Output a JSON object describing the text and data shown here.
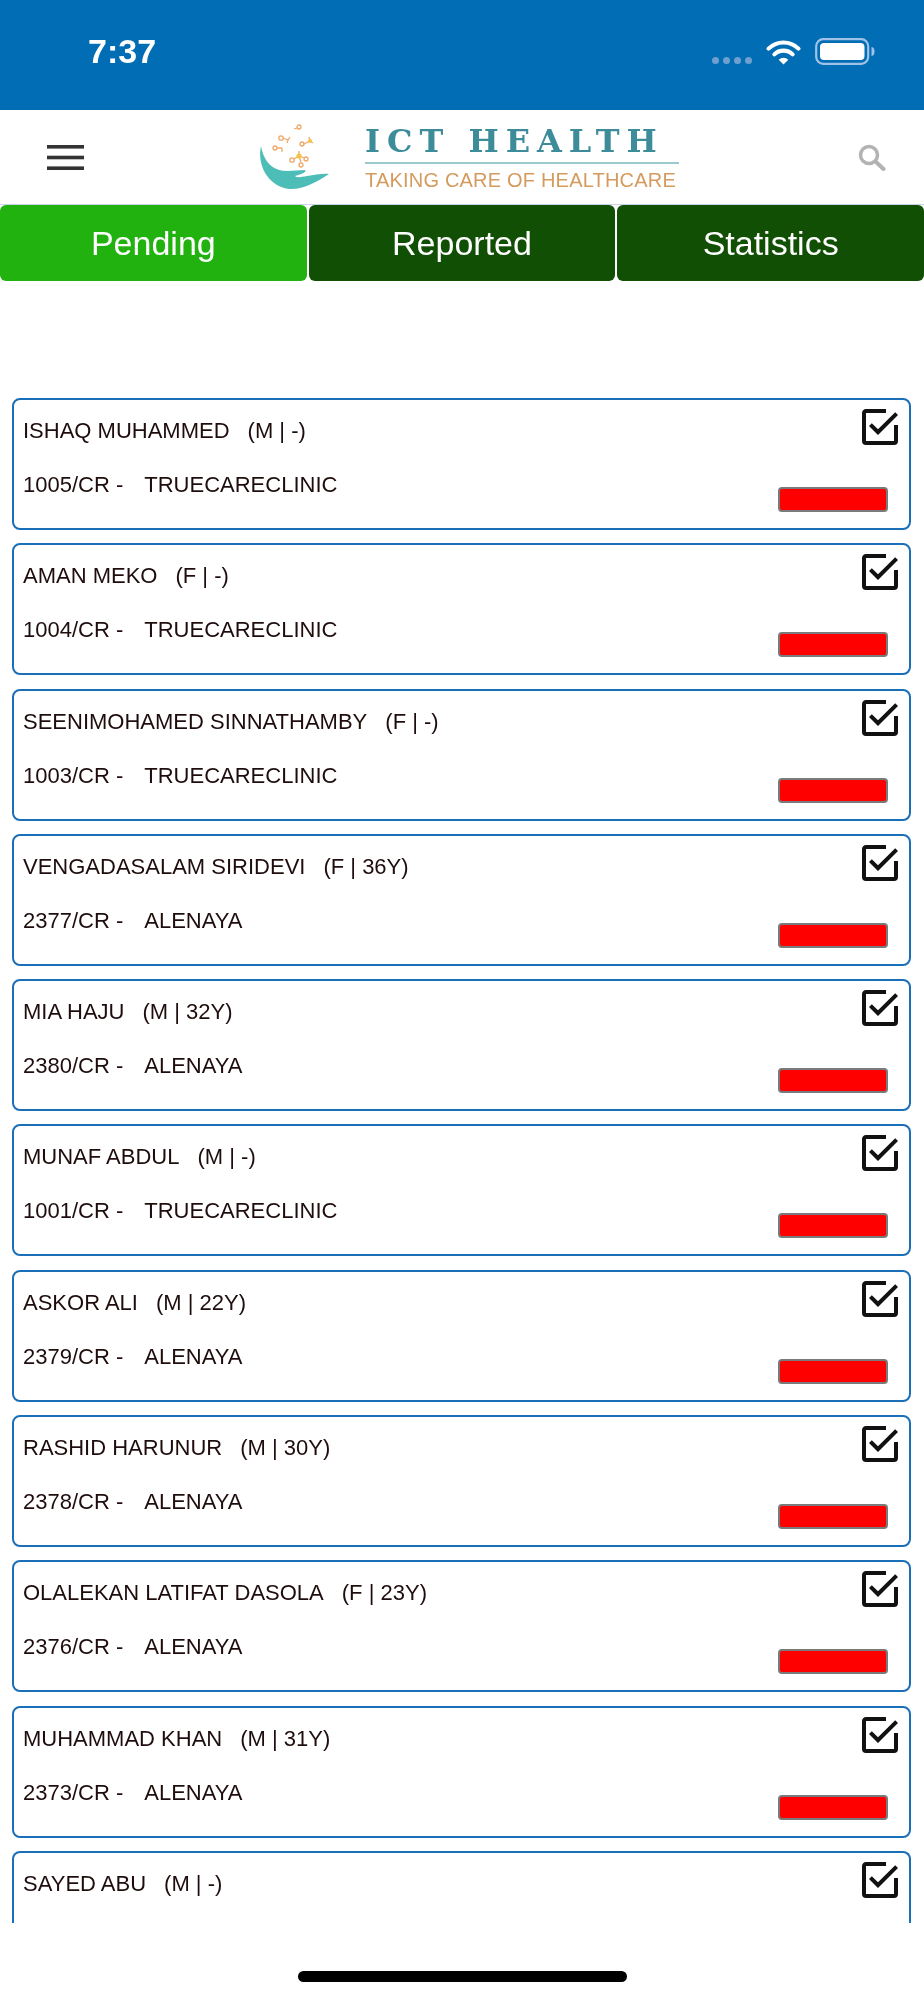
{
  "status_bar": {
    "time": "7:37"
  },
  "header": {
    "logo_title": "ICT HEALTH",
    "logo_tagline": "TAKING CARE OF HEALTHCARE"
  },
  "tabs": [
    {
      "label": "Pending",
      "selected": true
    },
    {
      "label": "Reported",
      "selected": false
    },
    {
      "label": "Statistics",
      "selected": false
    }
  ],
  "patients": [
    {
      "name": "ISHAQ MUHAMMED",
      "details": "(M | -)",
      "case_no": "1005/CR -",
      "clinic": "TRUECARECLINIC",
      "checked": true,
      "color": "#ff0000"
    },
    {
      "name": "AMAN MEKO",
      "details": "(F | -)",
      "case_no": "1004/CR -",
      "clinic": "TRUECARECLINIC",
      "checked": true,
      "color": "#ff0000"
    },
    {
      "name": "SEENIMOHAMED SINNATHAMBY",
      "details": "(F | -)",
      "case_no": "1003/CR -",
      "clinic": "TRUECARECLINIC",
      "checked": true,
      "color": "#ff0000"
    },
    {
      "name": "VENGADASALAM SIRIDEVI",
      "details": "(F | 36Y)",
      "case_no": "2377/CR -",
      "clinic": "ALENAYA",
      "checked": true,
      "color": "#ff0000"
    },
    {
      "name": "MIA HAJU",
      "details": "(M | 32Y)",
      "case_no": "2380/CR -",
      "clinic": "ALENAYA",
      "checked": true,
      "color": "#ff0000"
    },
    {
      "name": "MUNAF ABDUL",
      "details": "(M | -)",
      "case_no": "1001/CR -",
      "clinic": "TRUECARECLINIC",
      "checked": true,
      "color": "#ff0000"
    },
    {
      "name": "ASKOR ALI",
      "details": "(M | 22Y)",
      "case_no": "2379/CR -",
      "clinic": "ALENAYA",
      "checked": true,
      "color": "#ff0000"
    },
    {
      "name": "RASHID HARUNUR",
      "details": "(M | 30Y)",
      "case_no": "2378/CR -",
      "clinic": "ALENAYA",
      "checked": true,
      "color": "#ff0000"
    },
    {
      "name": "OLALEKAN LATIFAT DASOLA",
      "details": "(F | 23Y)",
      "case_no": "2376/CR -",
      "clinic": "ALENAYA",
      "checked": true,
      "color": "#ff0000"
    },
    {
      "name": "MUHAMMAD KHAN",
      "details": "(M | 31Y)",
      "case_no": "2373/CR -",
      "clinic": "ALENAYA",
      "checked": true,
      "color": "#ff0000"
    },
    {
      "name": "SAYED ABU",
      "details": "(M | -)",
      "checked": true
    }
  ]
}
